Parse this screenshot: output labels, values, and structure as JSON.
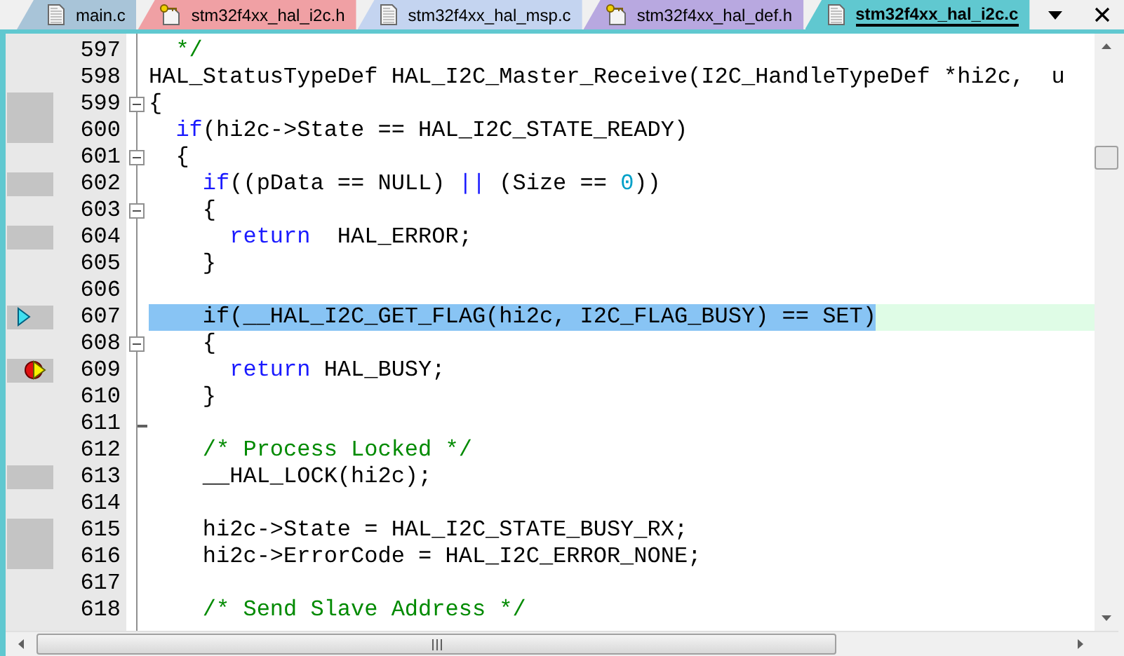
{
  "tabs": [
    {
      "label": "main.c",
      "kind": "file",
      "color": "#a8c4d8",
      "selected": false
    },
    {
      "label": "stm32f4xx_hal_i2c.h",
      "kind": "key-file",
      "color": "#f0a0a4",
      "selected": false
    },
    {
      "label": "stm32f4xx_hal_msp.c",
      "kind": "file",
      "color": "#c4d4f0",
      "selected": false
    },
    {
      "label": "stm32f4xx_hal_def.h",
      "kind": "key-file",
      "color": "#b8a8e0",
      "selected": false
    },
    {
      "label": "stm32f4xx_hal_i2c.c",
      "kind": "file",
      "color": "#60c8d0",
      "selected": true
    }
  ],
  "lines": [
    {
      "number": "597",
      "collapsible": false,
      "block_end": false,
      "covered": false,
      "highlighted": false,
      "execution_point": false,
      "breakpoint": false,
      "tokens": [
        {
          "kind": "comment",
          "text": "  */"
        }
      ]
    },
    {
      "number": "598",
      "collapsible": false,
      "block_end": false,
      "covered": false,
      "highlighted": false,
      "execution_point": false,
      "breakpoint": false,
      "tokens": [
        {
          "kind": "plain",
          "text": "HAL_StatusTypeDef HAL_I2C_Master_Receive(I2C_HandleTypeDef *hi2c,  u"
        }
      ]
    },
    {
      "number": "599",
      "collapsible": true,
      "block_end": false,
      "covered": true,
      "highlighted": false,
      "execution_point": false,
      "breakpoint": false,
      "tokens": [
        {
          "kind": "plain",
          "text": "{"
        }
      ]
    },
    {
      "number": "600",
      "collapsible": false,
      "block_end": false,
      "covered": true,
      "highlighted": false,
      "execution_point": false,
      "breakpoint": false,
      "tokens": [
        {
          "kind": "keyword",
          "text": "  if"
        },
        {
          "kind": "plain",
          "text": "(hi2c->State == HAL_I2C_STATE_READY)"
        }
      ]
    },
    {
      "number": "601",
      "collapsible": true,
      "block_end": false,
      "covered": false,
      "highlighted": false,
      "execution_point": false,
      "breakpoint": false,
      "tokens": [
        {
          "kind": "plain",
          "text": "  {"
        }
      ]
    },
    {
      "number": "602",
      "collapsible": false,
      "block_end": false,
      "covered": true,
      "highlighted": false,
      "execution_point": false,
      "breakpoint": false,
      "tokens": [
        {
          "kind": "keyword",
          "text": "    if"
        },
        {
          "kind": "plain",
          "text": "((pData == NULL) "
        },
        {
          "kind": "operator",
          "text": "||"
        },
        {
          "kind": "plain",
          "text": " (Size == "
        },
        {
          "kind": "number",
          "text": "0"
        },
        {
          "kind": "plain",
          "text": "))"
        }
      ]
    },
    {
      "number": "603",
      "collapsible": true,
      "block_end": false,
      "covered": false,
      "highlighted": false,
      "execution_point": false,
      "breakpoint": false,
      "tokens": [
        {
          "kind": "plain",
          "text": "    {"
        }
      ]
    },
    {
      "number": "604",
      "collapsible": false,
      "block_end": false,
      "covered": true,
      "highlighted": false,
      "execution_point": false,
      "breakpoint": false,
      "tokens": [
        {
          "kind": "keyword",
          "text": "      return"
        },
        {
          "kind": "plain",
          "text": "  HAL_ERROR;"
        }
      ]
    },
    {
      "number": "605",
      "collapsible": false,
      "block_end": false,
      "covered": false,
      "highlighted": false,
      "execution_point": false,
      "breakpoint": false,
      "tokens": [
        {
          "kind": "plain",
          "text": "    }"
        }
      ]
    },
    {
      "number": "606",
      "collapsible": false,
      "block_end": false,
      "covered": false,
      "highlighted": false,
      "execution_point": false,
      "breakpoint": false
    },
    {
      "number": "607",
      "collapsible": false,
      "block_end": false,
      "covered": true,
      "highlighted": true,
      "execution_point": true,
      "breakpoint": false,
      "tokens": [
        {
          "kind": "plain",
          "text": "    if(__HAL_I2C_GET_FLAG(hi2c, I2C_FLAG_BUSY) == SET)"
        }
      ]
    },
    {
      "number": "608",
      "collapsible": true,
      "block_end": false,
      "covered": false,
      "highlighted": false,
      "execution_point": false,
      "breakpoint": false,
      "tokens": [
        {
          "kind": "plain",
          "text": "    {"
        }
      ]
    },
    {
      "number": "609",
      "collapsible": false,
      "block_end": false,
      "covered": true,
      "highlighted": false,
      "execution_point": false,
      "breakpoint": true,
      "tokens": [
        {
          "kind": "keyword",
          "text": "      return"
        },
        {
          "kind": "plain",
          "text": " HAL_BUSY;"
        }
      ]
    },
    {
      "number": "610",
      "collapsible": false,
      "block_end": false,
      "covered": false,
      "highlighted": false,
      "execution_point": false,
      "breakpoint": false,
      "tokens": [
        {
          "kind": "plain",
          "text": "    }"
        }
      ]
    },
    {
      "number": "611",
      "collapsible": false,
      "block_end": true,
      "covered": false,
      "highlighted": false,
      "execution_point": false,
      "breakpoint": false
    },
    {
      "number": "612",
      "collapsible": false,
      "block_end": false,
      "covered": false,
      "highlighted": false,
      "execution_point": false,
      "breakpoint": false,
      "tokens": [
        {
          "kind": "comment",
          "text": "    /* Process Locked */"
        }
      ]
    },
    {
      "number": "613",
      "collapsible": false,
      "block_end": false,
      "covered": true,
      "highlighted": false,
      "execution_point": false,
      "breakpoint": false,
      "tokens": [
        {
          "kind": "plain",
          "text": "    __HAL_LOCK(hi2c);"
        }
      ]
    },
    {
      "number": "614",
      "collapsible": false,
      "block_end": false,
      "covered": false,
      "highlighted": false,
      "execution_point": false,
      "breakpoint": false
    },
    {
      "number": "615",
      "collapsible": false,
      "block_end": false,
      "covered": true,
      "highlighted": false,
      "execution_point": false,
      "breakpoint": false,
      "tokens": [
        {
          "kind": "plain",
          "text": "    hi2c->State = HAL_I2C_STATE_BUSY_RX;"
        }
      ]
    },
    {
      "number": "616",
      "collapsible": false,
      "block_end": false,
      "covered": true,
      "highlighted": false,
      "execution_point": false,
      "breakpoint": false,
      "tokens": [
        {
          "kind": "plain",
          "text": "    hi2c->ErrorCode = HAL_I2C_ERROR_NONE;"
        }
      ]
    },
    {
      "number": "617",
      "collapsible": false,
      "block_end": false,
      "covered": false,
      "highlighted": false,
      "execution_point": false,
      "breakpoint": false
    },
    {
      "number": "618",
      "collapsible": false,
      "block_end": false,
      "covered": false,
      "highlighted": false,
      "execution_point": false,
      "breakpoint": false,
      "tokens": [
        {
          "kind": "comment",
          "text": "    /* Send Slave Address */"
        }
      ]
    }
  ]
}
